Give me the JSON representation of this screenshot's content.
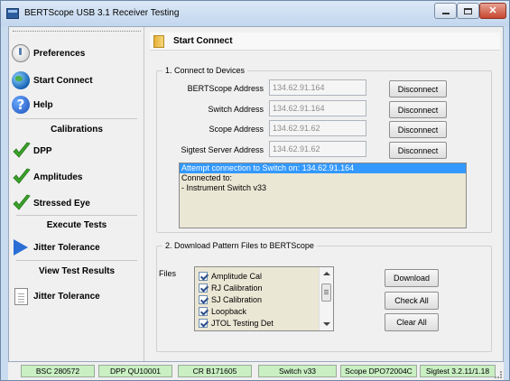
{
  "window": {
    "title": "BERTScope USB 3.1 Receiver Testing"
  },
  "sidebar": {
    "items_top": [
      {
        "label": "Preferences",
        "icon": "preferences-icon"
      },
      {
        "label": "Start Connect",
        "icon": "globe-icon"
      },
      {
        "label": "Help",
        "icon": "help-icon",
        "glyph": "?"
      }
    ],
    "calibrations": {
      "header": "Calibrations",
      "items": [
        {
          "label": "DPP",
          "icon": "checkmark-icon"
        },
        {
          "label": "Amplitudes",
          "icon": "checkmark-icon"
        },
        {
          "label": "Stressed Eye",
          "icon": "checkmark-icon"
        }
      ]
    },
    "execute": {
      "header": "Execute Tests",
      "items": [
        {
          "label": "Jitter Tolerance",
          "icon": "play-icon"
        }
      ]
    },
    "results": {
      "header": "View Test Results",
      "items": [
        {
          "label": "Jitter Tolerance",
          "icon": "document-icon"
        }
      ]
    }
  },
  "main": {
    "title": "Start Connect",
    "connect": {
      "group_title": "1. Connect to Devices",
      "rows": [
        {
          "label": "BERTScope Address",
          "value": "134.62.91.164",
          "button": "Disconnect"
        },
        {
          "label": "Switch Address",
          "value": "134.62.91.164",
          "button": "Disconnect"
        },
        {
          "label": "Scope Address",
          "value": "134.62.91.62",
          "button": "Disconnect"
        },
        {
          "label": "Sigtest Server Address",
          "value": "134.62.91.62",
          "button": "Disconnect"
        }
      ],
      "status_lines": [
        "Attempt connection to Switch on: 134.62.91.164",
        "Connected to:",
        " - Instrument Switch v33"
      ]
    },
    "download": {
      "group_title": "2. Download Pattern Files to BERTScope",
      "files_label": "Files",
      "files": [
        "Amplitude Cal",
        "RJ Calibration",
        "SJ Calibration",
        "Loopback",
        "JTOL Testing Det"
      ],
      "buttons": {
        "download": "Download",
        "check_all": "Check All",
        "clear_all": "Clear All"
      }
    }
  },
  "statusbar": {
    "cells": [
      "BSC 280572",
      "DPP QU10001",
      "CR B171605",
      "Switch v33",
      "Scope DPO72004C",
      "Sigtest 3.2.11/1.18"
    ],
    "color": "#c9efc3"
  },
  "colors": {
    "selection": "#3399ff",
    "panel_bg": "#ebe7d5",
    "check_green": "#3aa22b",
    "play_blue": "#2a6fd6"
  }
}
